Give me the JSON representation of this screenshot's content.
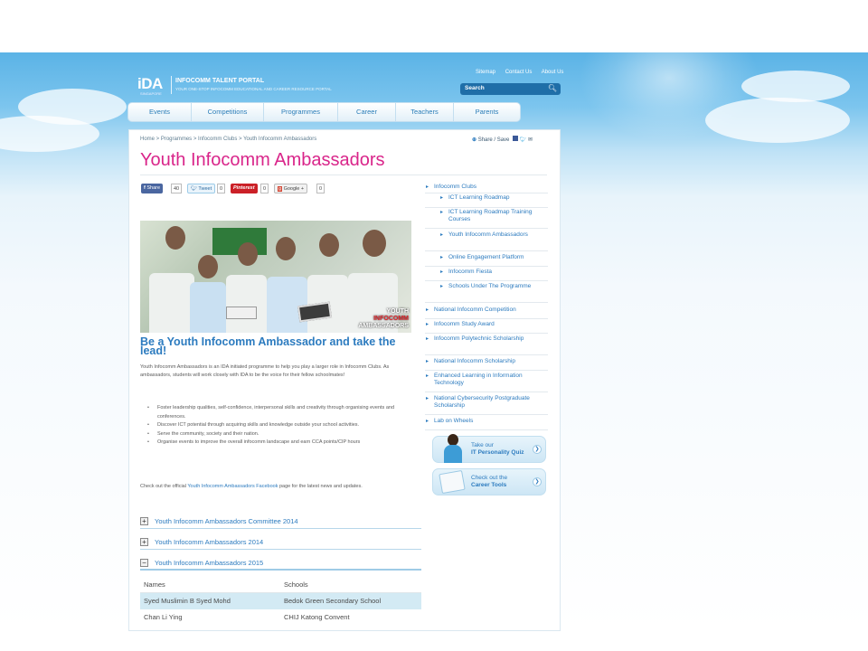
{
  "header": {
    "logo": "iDA",
    "logo_sub": "SINGAPORE",
    "portal_title": "INFOCOMM TALENT PORTAL",
    "portal_tagline": "YOUR ONE-STOP INFOCOMM EDUCATIONAL AND CAREER RESOURCE PORTAL",
    "links": [
      "Sitemap",
      "Contact Us",
      "About Us"
    ],
    "search_label": "Search"
  },
  "nav": [
    "Events",
    "Competitions",
    "Programmes",
    "Career",
    "Teachers",
    "Parents"
  ],
  "breadcrumb": "Home > Programmes > Infocomm Clubs > Youth Infocomm Ambassadors",
  "share_label": "Share / Save",
  "title": "Youth Infocomm Ambassadors",
  "social": {
    "share": "Share",
    "share_count": "40",
    "tweet": "Tweet",
    "tweet_count": "0",
    "pinterest": "Pinterest",
    "pinterest_count": "0",
    "google": "Google +",
    "google_count": "0"
  },
  "photo_caption": {
    "line1": "YOUTH",
    "line2": "INFOCOMM",
    "line3": "AMBASSADORS"
  },
  "subhead": "Be a Youth Infocomm Ambassador and take the lead!",
  "intro": "Youth Infocomm Ambassadors is an IDA initiated programme to help you play a larger role in Infocomm Clubs. As ambassadors, students will work closely with IDA to be the voice for their fellow schoolmates!",
  "bullets": [
    "Foster leadership qualities, self-confidence, interpersonal skills and creativity through organising events and conferences.",
    "Discover ICT potential through acquiring skills and knowledge outside your school activities.",
    "Serve the community, society and their nation.",
    "Organise events to improve the overall infocomm landscape and earn CCA points/CIP hours"
  ],
  "facebook": {
    "before": "Check out the official ",
    "link": "Youth Infocomm Ambassadors Facebook",
    "after": " page for the latest news and updates."
  },
  "accordions": [
    {
      "label": "Youth Infocomm Ambassadors Committee 2014",
      "state": "+"
    },
    {
      "label": "Youth Infocomm Ambassadors 2014",
      "state": "+"
    },
    {
      "label": "Youth Infocomm Ambassadors 2015",
      "state": "−"
    }
  ],
  "table": {
    "headers": [
      "Names",
      "Schools"
    ],
    "rows": [
      [
        "Syed Muslimin B Syed Mohd",
        "Bedok Green Secondary School"
      ],
      [
        "Chan Li Ying",
        "CHIJ Katong Convent"
      ]
    ]
  },
  "sidebar": [
    {
      "label": "Infocomm Clubs",
      "level": 0
    },
    {
      "label": "ICT Learning Roadmap",
      "level": 1
    },
    {
      "label": "ICT Learning Roadmap Training Courses",
      "level": 1
    },
    {
      "label": "Youth Infocomm Ambassadors",
      "level": 1
    },
    {
      "label": "Online Engagement Platform",
      "level": 1
    },
    {
      "label": "Infocomm Fiesta",
      "level": 1
    },
    {
      "label": "Schools Under The Programme",
      "level": 1
    },
    {
      "label": "National Infocomm Competition",
      "level": 0
    },
    {
      "label": "Infocomm Study Award",
      "level": 0
    },
    {
      "label": "Infocomm Polytechnic Scholarship",
      "level": 0
    },
    {
      "label": "National Infocomm Scholarship",
      "level": 0
    },
    {
      "label": "Enhanced Learning in Information Technology",
      "level": 0
    },
    {
      "label": "National Cybersecurity Postgraduate Scholarship",
      "level": 0
    },
    {
      "label": "Lab on Wheels",
      "level": 0
    }
  ],
  "promos": [
    {
      "line1": "Take our",
      "line2": "IT Personality Quiz"
    },
    {
      "line1": "Check out the",
      "line2": "Career Tools"
    }
  ]
}
